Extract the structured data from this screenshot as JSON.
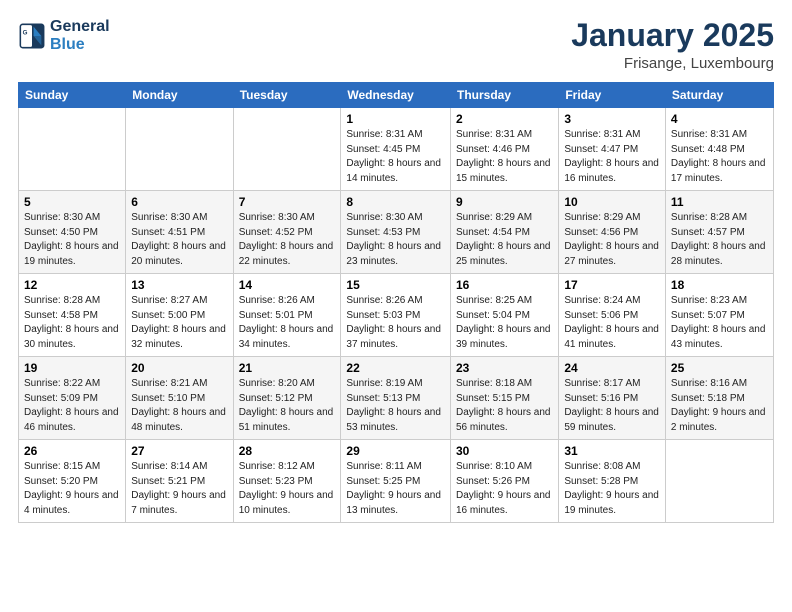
{
  "logo": {
    "line1": "General",
    "line2": "Blue"
  },
  "title": "January 2025",
  "subtitle": "Frisange, Luxembourg",
  "headers": [
    "Sunday",
    "Monday",
    "Tuesday",
    "Wednesday",
    "Thursday",
    "Friday",
    "Saturday"
  ],
  "weeks": [
    [
      {
        "num": "",
        "info": ""
      },
      {
        "num": "",
        "info": ""
      },
      {
        "num": "",
        "info": ""
      },
      {
        "num": "1",
        "info": "Sunrise: 8:31 AM\nSunset: 4:45 PM\nDaylight: 8 hours\nand 14 minutes."
      },
      {
        "num": "2",
        "info": "Sunrise: 8:31 AM\nSunset: 4:46 PM\nDaylight: 8 hours\nand 15 minutes."
      },
      {
        "num": "3",
        "info": "Sunrise: 8:31 AM\nSunset: 4:47 PM\nDaylight: 8 hours\nand 16 minutes."
      },
      {
        "num": "4",
        "info": "Sunrise: 8:31 AM\nSunset: 4:48 PM\nDaylight: 8 hours\nand 17 minutes."
      }
    ],
    [
      {
        "num": "5",
        "info": "Sunrise: 8:30 AM\nSunset: 4:50 PM\nDaylight: 8 hours\nand 19 minutes."
      },
      {
        "num": "6",
        "info": "Sunrise: 8:30 AM\nSunset: 4:51 PM\nDaylight: 8 hours\nand 20 minutes."
      },
      {
        "num": "7",
        "info": "Sunrise: 8:30 AM\nSunset: 4:52 PM\nDaylight: 8 hours\nand 22 minutes."
      },
      {
        "num": "8",
        "info": "Sunrise: 8:30 AM\nSunset: 4:53 PM\nDaylight: 8 hours\nand 23 minutes."
      },
      {
        "num": "9",
        "info": "Sunrise: 8:29 AM\nSunset: 4:54 PM\nDaylight: 8 hours\nand 25 minutes."
      },
      {
        "num": "10",
        "info": "Sunrise: 8:29 AM\nSunset: 4:56 PM\nDaylight: 8 hours\nand 27 minutes."
      },
      {
        "num": "11",
        "info": "Sunrise: 8:28 AM\nSunset: 4:57 PM\nDaylight: 8 hours\nand 28 minutes."
      }
    ],
    [
      {
        "num": "12",
        "info": "Sunrise: 8:28 AM\nSunset: 4:58 PM\nDaylight: 8 hours\nand 30 minutes."
      },
      {
        "num": "13",
        "info": "Sunrise: 8:27 AM\nSunset: 5:00 PM\nDaylight: 8 hours\nand 32 minutes."
      },
      {
        "num": "14",
        "info": "Sunrise: 8:26 AM\nSunset: 5:01 PM\nDaylight: 8 hours\nand 34 minutes."
      },
      {
        "num": "15",
        "info": "Sunrise: 8:26 AM\nSunset: 5:03 PM\nDaylight: 8 hours\nand 37 minutes."
      },
      {
        "num": "16",
        "info": "Sunrise: 8:25 AM\nSunset: 5:04 PM\nDaylight: 8 hours\nand 39 minutes."
      },
      {
        "num": "17",
        "info": "Sunrise: 8:24 AM\nSunset: 5:06 PM\nDaylight: 8 hours\nand 41 minutes."
      },
      {
        "num": "18",
        "info": "Sunrise: 8:23 AM\nSunset: 5:07 PM\nDaylight: 8 hours\nand 43 minutes."
      }
    ],
    [
      {
        "num": "19",
        "info": "Sunrise: 8:22 AM\nSunset: 5:09 PM\nDaylight: 8 hours\nand 46 minutes."
      },
      {
        "num": "20",
        "info": "Sunrise: 8:21 AM\nSunset: 5:10 PM\nDaylight: 8 hours\nand 48 minutes."
      },
      {
        "num": "21",
        "info": "Sunrise: 8:20 AM\nSunset: 5:12 PM\nDaylight: 8 hours\nand 51 minutes."
      },
      {
        "num": "22",
        "info": "Sunrise: 8:19 AM\nSunset: 5:13 PM\nDaylight: 8 hours\nand 53 minutes."
      },
      {
        "num": "23",
        "info": "Sunrise: 8:18 AM\nSunset: 5:15 PM\nDaylight: 8 hours\nand 56 minutes."
      },
      {
        "num": "24",
        "info": "Sunrise: 8:17 AM\nSunset: 5:16 PM\nDaylight: 8 hours\nand 59 minutes."
      },
      {
        "num": "25",
        "info": "Sunrise: 8:16 AM\nSunset: 5:18 PM\nDaylight: 9 hours\nand 2 minutes."
      }
    ],
    [
      {
        "num": "26",
        "info": "Sunrise: 8:15 AM\nSunset: 5:20 PM\nDaylight: 9 hours\nand 4 minutes."
      },
      {
        "num": "27",
        "info": "Sunrise: 8:14 AM\nSunset: 5:21 PM\nDaylight: 9 hours\nand 7 minutes."
      },
      {
        "num": "28",
        "info": "Sunrise: 8:12 AM\nSunset: 5:23 PM\nDaylight: 9 hours\nand 10 minutes."
      },
      {
        "num": "29",
        "info": "Sunrise: 8:11 AM\nSunset: 5:25 PM\nDaylight: 9 hours\nand 13 minutes."
      },
      {
        "num": "30",
        "info": "Sunrise: 8:10 AM\nSunset: 5:26 PM\nDaylight: 9 hours\nand 16 minutes."
      },
      {
        "num": "31",
        "info": "Sunrise: 8:08 AM\nSunset: 5:28 PM\nDaylight: 9 hours\nand 19 minutes."
      },
      {
        "num": "",
        "info": ""
      }
    ]
  ]
}
